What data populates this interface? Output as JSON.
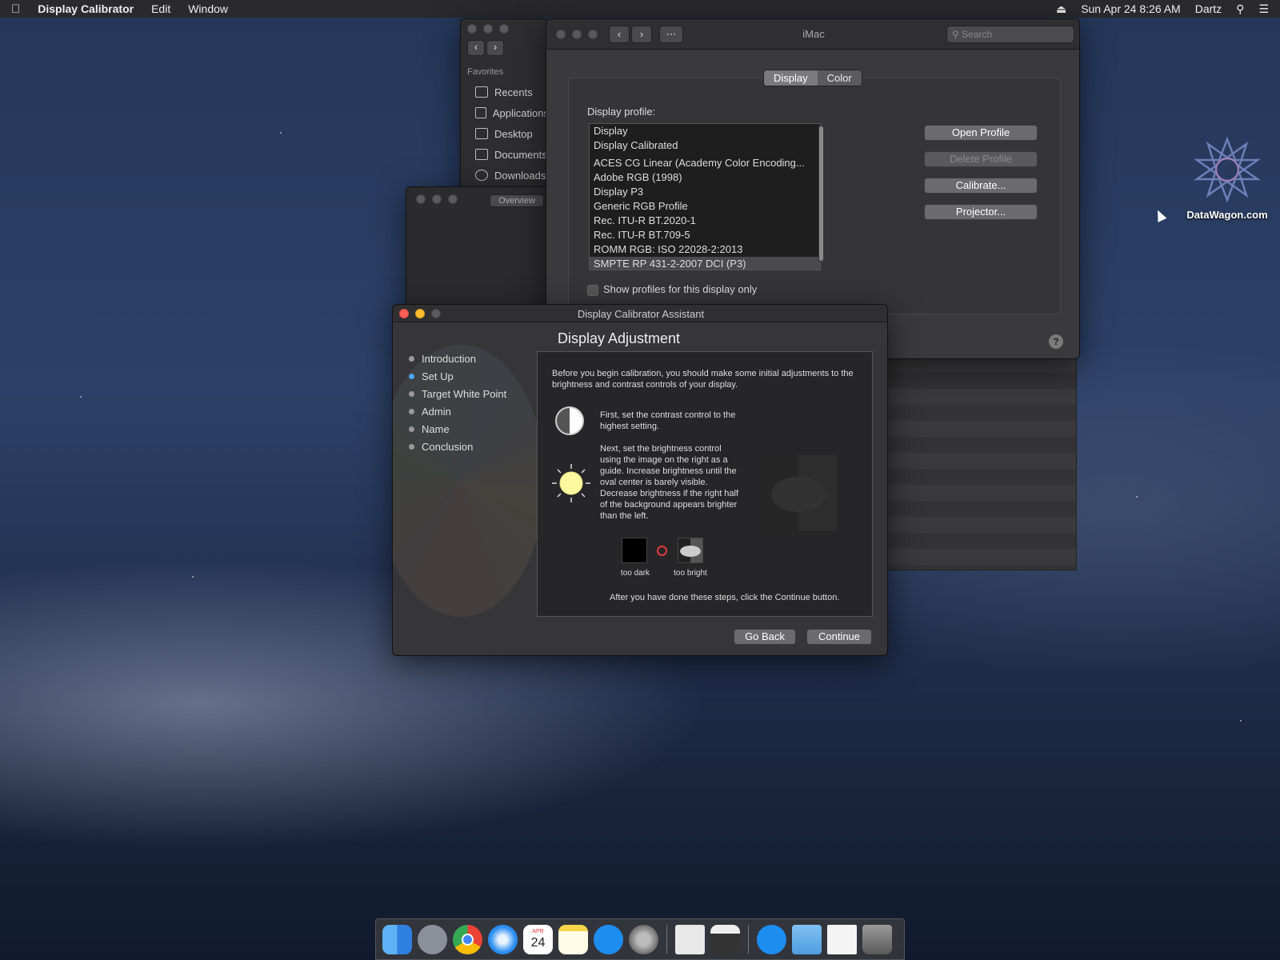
{
  "menubar": {
    "app_name": "Display Calibrator",
    "menus": [
      "Edit",
      "Window"
    ],
    "clock": "Sun Apr 24  8:26 AM",
    "user": "Dartz"
  },
  "finder": {
    "section": "Favorites",
    "items": [
      "Recents",
      "Applications",
      "Desktop",
      "Documents",
      "Downloads"
    ],
    "tab": "Overview"
  },
  "prefs": {
    "title": "iMac",
    "search_placeholder": "Search",
    "tabs": [
      "Display",
      "Color"
    ],
    "active_tab": "Color",
    "profile_label": "Display profile:",
    "profiles": [
      "Display",
      "Display Calibrated",
      "ACES CG Linear (Academy Color Encoding...",
      "Adobe RGB (1998)",
      "Display P3",
      "Generic RGB Profile",
      "Rec. ITU-R BT.2020-1",
      "Rec. ITU-R BT.709-5",
      "ROMM RGB: ISO 22028-2:2013",
      "SMPTE RP 431-2-2007 DCI (P3)"
    ],
    "buttons": {
      "open": "Open Profile",
      "delete": "Delete Profile",
      "calibrate": "Calibrate...",
      "projector": "Projector..."
    },
    "checkbox_label": "Show profiles for this display only",
    "help": "?"
  },
  "assistant": {
    "title": "Display Calibrator Assistant",
    "heading": "Display Adjustment",
    "steps": [
      "Introduction",
      "Set Up",
      "Target White Point",
      "Admin",
      "Name",
      "Conclusion"
    ],
    "active_step": "Set Up",
    "intro": "Before you begin calibration, you should make some initial adjustments to the brightness and contrast controls of your display.",
    "contrast_text": "First, set the contrast control to the highest setting.",
    "brightness_text": "Next, set the brightness control using the image on the right as a guide.  Increase brightness until the oval center is barely visible. Decrease brightness if the right half of the background appears brighter than the left.",
    "too_dark": "too dark",
    "too_bright": "too bright",
    "footer_text": "After you have done these steps, click the Continue button.",
    "go_back": "Go Back",
    "continue": "Continue"
  },
  "desktop_icon": {
    "label": "DataWagon.com"
  },
  "dock": {
    "apps": [
      "finder-icon",
      "launchpad-icon",
      "chrome-icon",
      "safari-icon",
      "calendar-icon",
      "notes-icon",
      "app-store-icon",
      "system-preferences-icon",
      "preview-icon",
      "script-editor-icon",
      "app-store-icon-2",
      "downloads-folder-icon",
      "document-icon",
      "trash-icon"
    ],
    "calendar_month": "APR",
    "calendar_day": "24"
  },
  "colors": {
    "accent": "#4da3ff",
    "close": "#fc5f57",
    "minimize": "#fdbc2e"
  }
}
